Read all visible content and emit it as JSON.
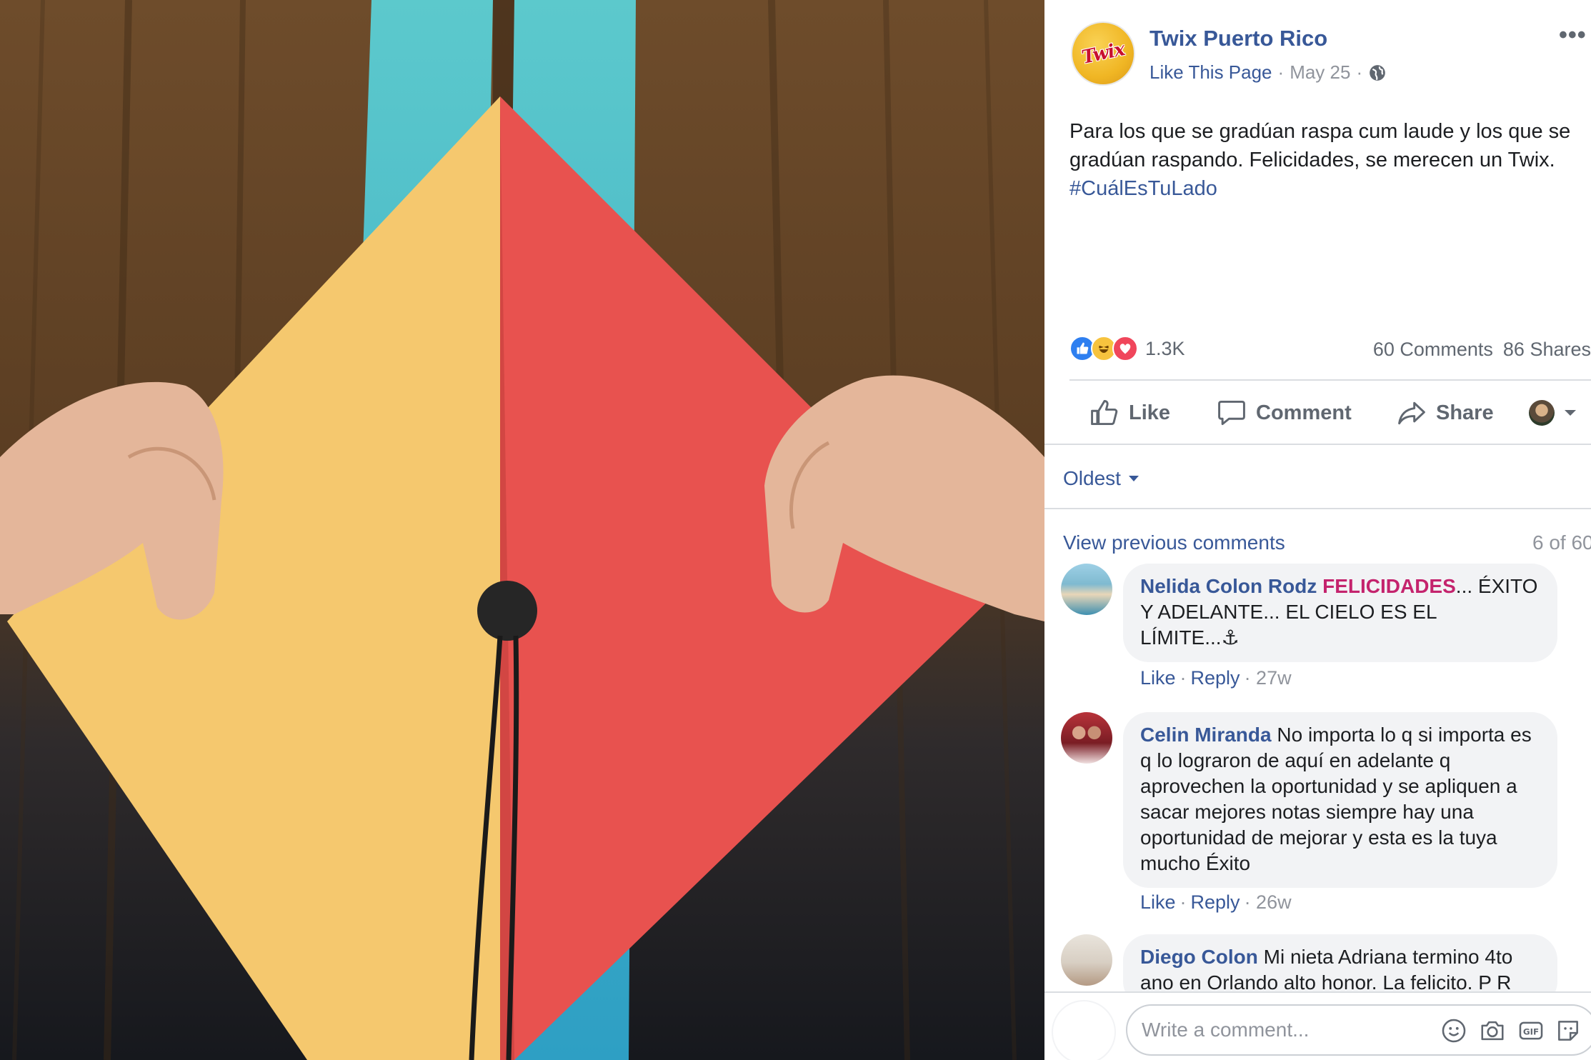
{
  "post": {
    "page_name": "Twix Puerto Rico",
    "logo_text": "Twix",
    "like_page": "Like This Page",
    "dot": "·",
    "date": "May 25",
    "dot2": "·",
    "text": "Para los que se gradúan raspa cum laude y los que se gradúan raspando. Felicidades, se merecen un Twix.",
    "hashtag": "#CuálEsTuLado",
    "reaction_count": "1.3K",
    "comments_count": "60 Comments",
    "shares_count": "86 Shares",
    "icons": [
      "globe-icon",
      "more-icon",
      "like-reaction-icon",
      "haha-reaction-icon",
      "love-reaction-icon"
    ]
  },
  "actions": {
    "like": "Like",
    "comment": "Comment",
    "share": "Share"
  },
  "comments_section": {
    "sort_label": "Oldest",
    "view_previous": "View previous comments",
    "count_label": "6 of 60",
    "comments": [
      {
        "author": "Nelida Colon Rodz",
        "caps": "FELICIDADES",
        "text": "... ÉXITO Y ADELANTE... EL CIELO ES EL LÍMITE...⚓",
        "like": "Like",
        "reply": "Reply",
        "sep": "·",
        "time": "· 27w"
      },
      {
        "author": "Celin Miranda",
        "text": "No importa lo q si importa es q lo lograron de aquí en adelante q aprovechen la oportunidad y se apliquen a sacar mejores notas siempre hay una oportunidad de mejorar y esta es la tuya mucho Éxito",
        "like": "Like",
        "reply": "Reply",
        "sep": "·",
        "time": "· 26w"
      },
      {
        "author": "Diego Colon",
        "text": "Mi nieta Adriana termino 4to ano en Orlando alto honor. La felicito. P R"
      }
    ]
  },
  "composer": {
    "placeholder": "Write a comment..."
  },
  "colors": {
    "link": "#385898",
    "gown_brown": "#5c3e22",
    "stole_teal": "#4bbfc4",
    "cap_yellow": "#f5c86e",
    "cap_red": "#e8524f"
  }
}
